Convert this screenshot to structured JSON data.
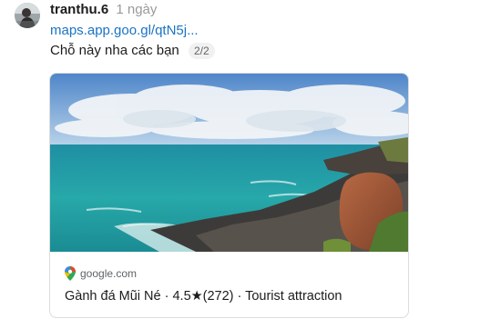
{
  "post": {
    "username": "tranthu.6",
    "time": "1 ngày",
    "link_text": "maps.app.goo.gl/qtN5j...",
    "message": "Chỗ này nha các bạn",
    "page_indicator": "2/2"
  },
  "link_card": {
    "domain": "google.com",
    "title": "Gành đá Mũi Né · 4.5★(272) · Tourist attraction",
    "image_subject": "coastal-rocks-turquoise-sea-photo",
    "icon": "google-maps-pin-icon"
  },
  "colors": {
    "link": "#1a73c4",
    "muted": "#9a9a9a",
    "card_border": "#dcdcdc"
  }
}
